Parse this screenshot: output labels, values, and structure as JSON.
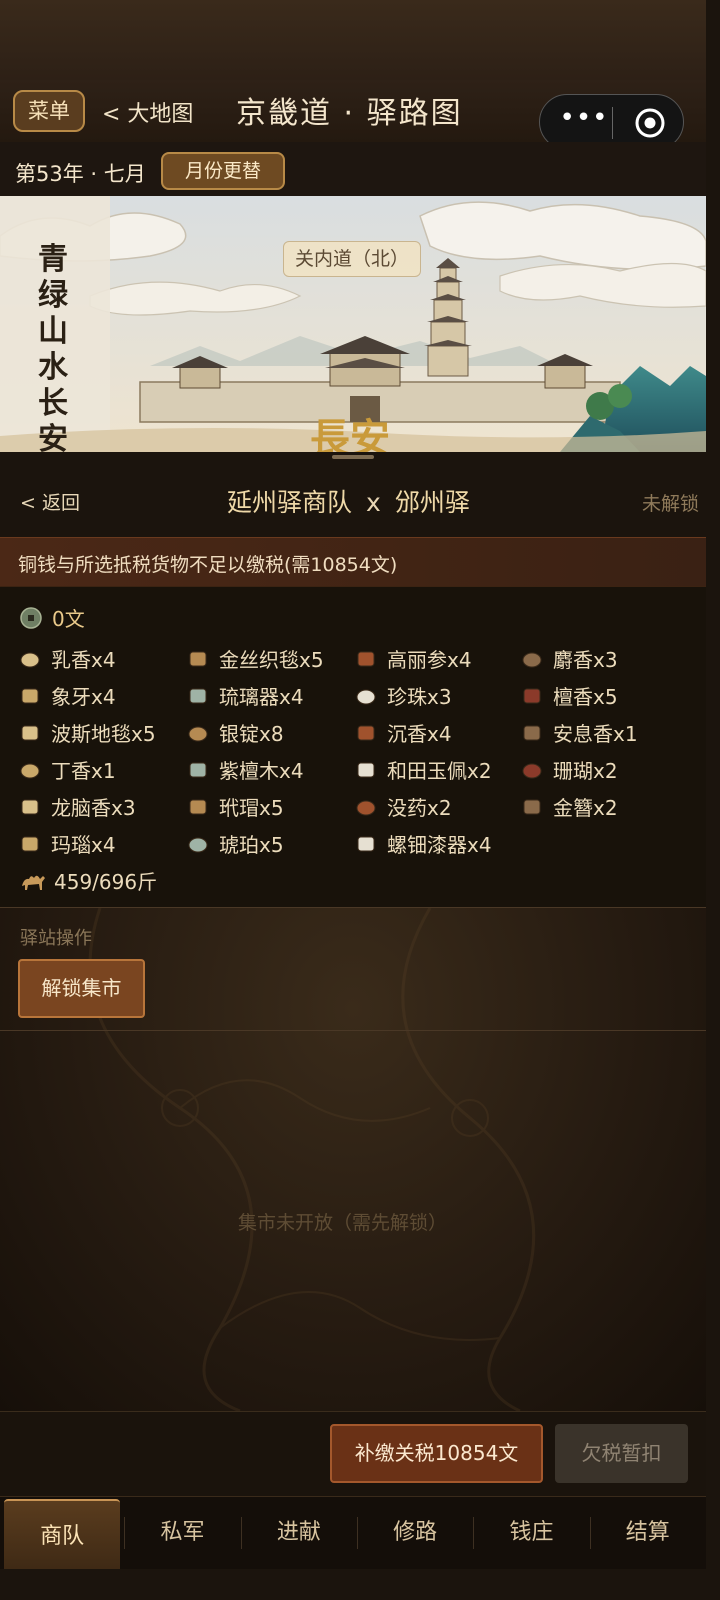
{
  "nav": {
    "menu_label": "菜单",
    "back_label": "< 大地图",
    "title": "京畿道 · 驿路图",
    "capsule_more": "•••"
  },
  "date_bar": {
    "date_text": "第53年 · 七月",
    "month_button": "月份更替"
  },
  "scene": {
    "caption": "关内道（北）",
    "side_text": "青绿山水长安",
    "city_text": "長安"
  },
  "panel": {
    "back_label": "< 返回",
    "route_from": "延州驿商队",
    "route_sep": "x",
    "route_to": "邠州驿",
    "status": "未解锁"
  },
  "warning": "铜钱与所选抵税货物不足以缴税(需10854文)",
  "inventory": {
    "money": "0文",
    "goods": [
      {
        "label": "乳香x4",
        "icon": "frankincense-icon"
      },
      {
        "label": "金丝织毯x5",
        "icon": "gold-carpet-icon"
      },
      {
        "label": "高丽参x4",
        "icon": "ginseng-icon"
      },
      {
        "label": "麝香x3",
        "icon": "musk-icon"
      },
      {
        "label": "象牙x4",
        "icon": "ivory-icon"
      },
      {
        "label": "琉璃器x4",
        "icon": "glassware-icon"
      },
      {
        "label": "珍珠x3",
        "icon": "pearl-icon"
      },
      {
        "label": "檀香x5",
        "icon": "sandalwood-icon"
      },
      {
        "label": "波斯地毯x5",
        "icon": "persian-rug-icon"
      },
      {
        "label": "银锭x8",
        "icon": "silver-ingot-icon"
      },
      {
        "label": "沉香x4",
        "icon": "agarwood-icon"
      },
      {
        "label": "安息香x1",
        "icon": "benzoin-icon"
      },
      {
        "label": "丁香x1",
        "icon": "clove-icon"
      },
      {
        "label": "紫檀木x4",
        "icon": "rosewood-icon"
      },
      {
        "label": "和田玉佩x2",
        "icon": "jade-pendant-icon"
      },
      {
        "label": "珊瑚x2",
        "icon": "coral-icon"
      },
      {
        "label": "龙脑香x3",
        "icon": "borneol-icon"
      },
      {
        "label": "玳瑁x5",
        "icon": "tortoiseshell-icon"
      },
      {
        "label": "没药x2",
        "icon": "myrrh-icon"
      },
      {
        "label": "金簪x2",
        "icon": "gold-hairpin-icon"
      },
      {
        "label": "玛瑙x4",
        "icon": "agate-icon"
      },
      {
        "label": "琥珀x5",
        "icon": "amber-icon"
      },
      {
        "label": "螺钿漆器x4",
        "icon": "lacquerware-icon"
      }
    ],
    "weight": "459/696斤"
  },
  "station_ops": {
    "label": "驿站操作",
    "unlock_button": "解锁集市"
  },
  "market": {
    "empty_text": "集市未开放（需先解锁）"
  },
  "footer": {
    "pay_button": "补缴关税10854文",
    "defer_button": "欠税暂扣"
  },
  "tabs": [
    {
      "label": "商队",
      "active": true
    },
    {
      "label": "私军",
      "active": false
    },
    {
      "label": "进献",
      "active": false
    },
    {
      "label": "修路",
      "active": false
    },
    {
      "label": "钱庄",
      "active": false
    },
    {
      "label": "结算",
      "active": false
    }
  ],
  "colors": {
    "background": "#1b140d",
    "accent_gold": "#b88a47",
    "title_gold": "#efd9a8",
    "warning_bg": "#4b2816",
    "button_brown": "#7a4520"
  }
}
